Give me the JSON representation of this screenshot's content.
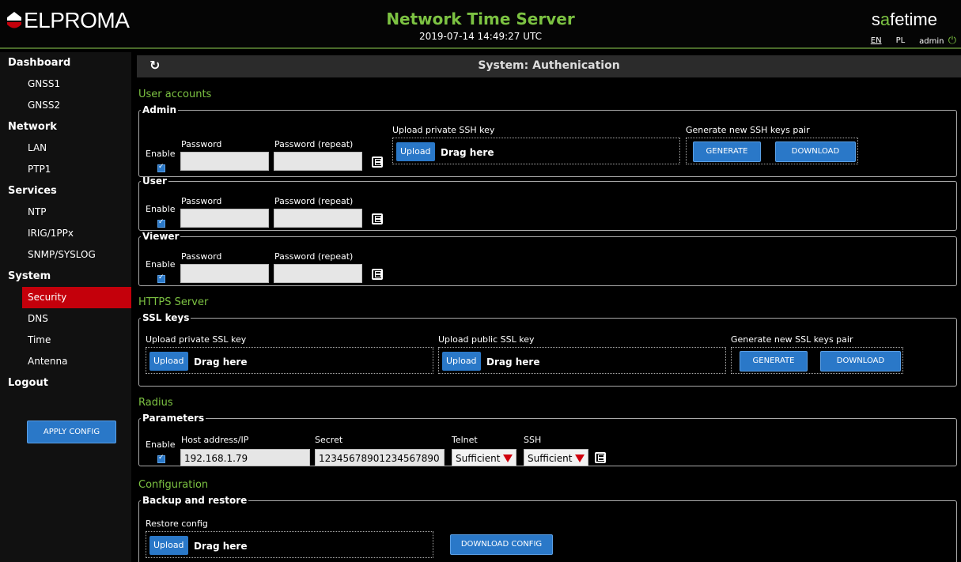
{
  "header": {
    "logo_text": "ELPROMA",
    "title": "Network Time Server",
    "datetime": "2019-07-14 14:49:27 UTC",
    "brand_prefix": "s",
    "brand_accent": "a",
    "brand_suffix": "fetime",
    "lang_en": "EN",
    "lang_pl": "PL",
    "user": "admin"
  },
  "sidebar": {
    "sections": [
      {
        "label": "Dashboard",
        "items": [
          "GNSS1",
          "GNSS2"
        ]
      },
      {
        "label": "Network",
        "items": [
          "LAN",
          "PTP1"
        ]
      },
      {
        "label": "Services",
        "items": [
          "NTP",
          "IRIG/1PPx",
          "SNMP/SYSLOG"
        ]
      },
      {
        "label": "System",
        "items": [
          "Security",
          "DNS",
          "Time",
          "Antenna"
        ]
      },
      {
        "label": "Logout",
        "items": []
      }
    ],
    "active_item": "Security",
    "apply_button": "APPLY CONFIG"
  },
  "main": {
    "title": "System: Authenication",
    "user_accounts": {
      "title": "User accounts",
      "enable_label": "Enable",
      "password_label": "Password",
      "password_repeat_label": "Password (repeat)",
      "admin": {
        "legend": "Admin",
        "enabled": true,
        "upload_ssh_label": "Upload private SSH key",
        "upload_button": "Upload",
        "drag_text": "Drag here",
        "generate_label": "Generate new SSH keys pair",
        "generate_button": "GENERATE",
        "download_button": "DOWNLOAD"
      },
      "user": {
        "legend": "User",
        "enabled": true
      },
      "viewer": {
        "legend": "Viewer",
        "enabled": true
      }
    },
    "https": {
      "title": "HTTPS Server",
      "legend": "SSL keys",
      "private_label": "Upload private SSL key",
      "public_label": "Upload public SSL key",
      "upload_button": "Upload",
      "drag_text": "Drag here",
      "generate_label": "Generate new SSL keys pair",
      "generate_button": "GENERATE",
      "download_button": "DOWNLOAD"
    },
    "radius": {
      "title": "Radius",
      "legend": "Parameters",
      "enable_label": "Enable",
      "enabled": true,
      "host_label": "Host address/IP",
      "host_value": "192.168.1.79",
      "secret_label": "Secret",
      "secret_value": "12345678901234567890",
      "telnet_label": "Telnet",
      "telnet_value": "Sufficient",
      "ssh_label": "SSH",
      "ssh_value": "Sufficient"
    },
    "configuration": {
      "title": "Configuration",
      "legend": "Backup and restore",
      "restore_label": "Restore config",
      "upload_button": "Upload",
      "drag_text": "Drag here",
      "download_button": "DOWNLOAD CONFIG"
    }
  },
  "colors": {
    "accent_green": "#7cc242",
    "button_blue": "#2a78c8",
    "active_red": "#c4000b"
  }
}
